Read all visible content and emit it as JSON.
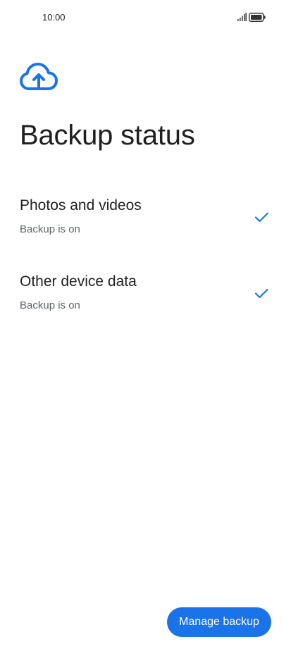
{
  "status_bar": {
    "time": "10:00"
  },
  "header": {
    "icon": "cloud-upload-icon",
    "title": "Backup status"
  },
  "items": [
    {
      "title": "Photos and videos",
      "subtitle": "Backup is on",
      "icon": "check-icon"
    },
    {
      "title": "Other device data",
      "subtitle": "Backup is on",
      "icon": "check-icon"
    }
  ],
  "footer": {
    "manage_label": "Manage backup"
  },
  "colors": {
    "accent": "#1a73e8",
    "text_primary": "#1f1f1f",
    "text_secondary": "#5f6368"
  }
}
